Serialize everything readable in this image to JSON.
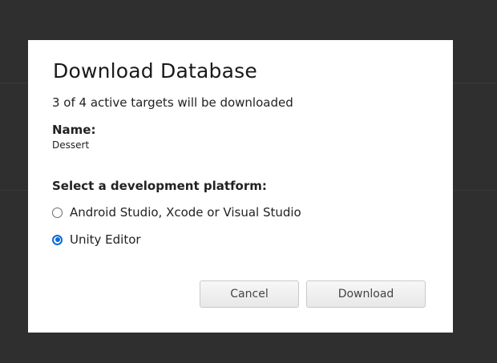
{
  "dialog": {
    "title": "Download Database",
    "subtitle": "3 of 4 active targets will be downloaded",
    "name_label": "Name:",
    "name_value": "Dessert",
    "platform_label": "Select a development platform:",
    "options": [
      {
        "label": "Android Studio, Xcode or Visual Studio",
        "selected": false
      },
      {
        "label": "Unity Editor",
        "selected": true
      }
    ],
    "cancel_label": "Cancel",
    "download_label": "Download"
  },
  "colors": {
    "overlay": "#2f2f2f",
    "accent": "#0a6cdb"
  }
}
